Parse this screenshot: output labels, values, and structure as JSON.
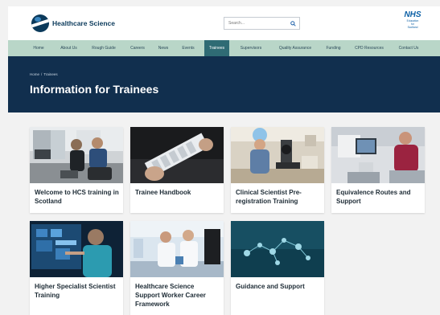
{
  "header": {
    "logo_text": "Healthcare Science",
    "search_placeholder": "Search...",
    "partner_logo": {
      "name": "NHS",
      "sub": [
        "Education",
        "for",
        "Scotland"
      ]
    }
  },
  "nav": {
    "items": [
      "Home",
      "About Us",
      "Rough Guide",
      "Careers",
      "News",
      "Events",
      "Trainees",
      "Supervisors",
      "Quality Assurance",
      "Funding",
      "CPD Resources",
      "Contact Us"
    ],
    "active": "Trainees"
  },
  "hero": {
    "breadcrumb": [
      "Home",
      "Trainees"
    ],
    "breadcrumb_separator": "/",
    "title": "Information for Trainees"
  },
  "cards": [
    {
      "title": "Welcome to HCS training in Scotland",
      "image": "gym-training-photo"
    },
    {
      "title": "Trainee Handbook",
      "image": "test-slide-photo"
    },
    {
      "title": "Clinical Scientist Pre-registration Training",
      "image": "microscope-lab-photo"
    },
    {
      "title": "Equivalence Routes and Support",
      "image": "scientist-at-computer-photo"
    },
    {
      "title": "Higher Specialist Scientist Training",
      "image": "touchscreen-photo"
    },
    {
      "title": "Healthcare Science Support Worker Career Framework",
      "image": "lab-team-photo"
    },
    {
      "title": "Guidance and Support",
      "image": "molecules-photo"
    }
  ],
  "colors": {
    "brand_navy": "#112f4e",
    "nav_green": "#b9d6c8",
    "nav_active": "#2f6b74",
    "nhs_blue": "#0b5fa5"
  }
}
